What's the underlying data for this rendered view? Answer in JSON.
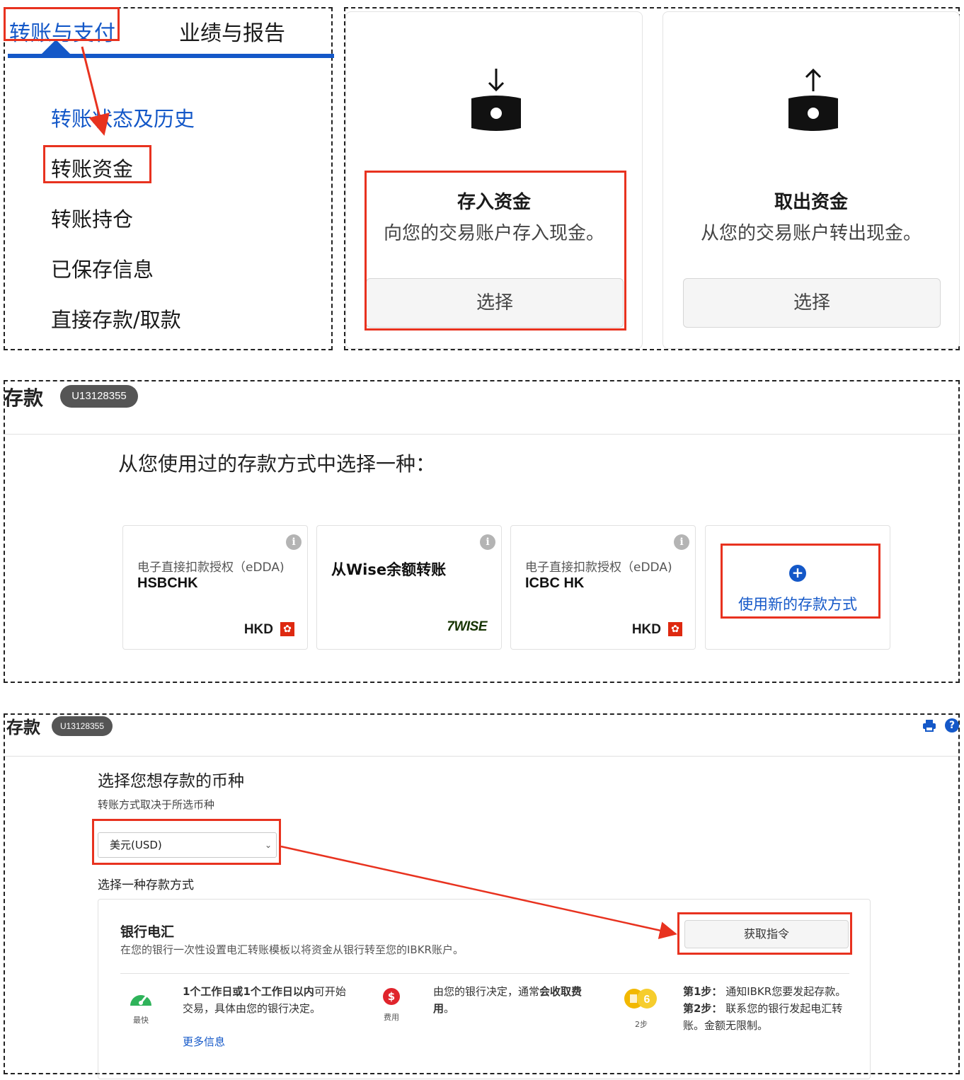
{
  "top_nav": {
    "tabs": [
      {
        "label": "转账与支付",
        "active": true
      },
      {
        "label": "业绩与报告",
        "active": false
      }
    ],
    "menu_items": [
      {
        "label": "转账状态及历史"
      },
      {
        "label": "转账资金"
      },
      {
        "label": "转账持仓"
      },
      {
        "label": "已保存信息"
      },
      {
        "label": "直接存款/取款"
      }
    ]
  },
  "fund_options": {
    "deposit": {
      "title": "存入资金",
      "description": "向您的交易账户存入现金。",
      "button": "选择",
      "icon": "money-arrow-down-icon"
    },
    "withdraw": {
      "title": "取出资金",
      "description": "从您的交易账户转出现金。",
      "button": "选择",
      "icon": "money-arrow-up-icon"
    }
  },
  "deposit_methods_page": {
    "title": "存款",
    "account_id": "U13128355",
    "prompt": "从您使用过的存款方式中选择一种：",
    "methods": [
      {
        "subtitle": "电子直接扣款授权（eDDA)",
        "name": "HSBCHK",
        "currency": "HKD",
        "flag_icon": "hong-kong-flag-icon"
      },
      {
        "title": "从Wise余额转账",
        "logo": "7WISE"
      },
      {
        "subtitle": "电子直接扣款授权（eDDA)",
        "name": "ICBC HK",
        "currency": "HKD",
        "flag_icon": "hong-kong-flag-icon"
      }
    ],
    "new_method_label": "使用新的存款方式"
  },
  "currency_page": {
    "title": "存款",
    "account_id": "U13128355",
    "heading": "选择您想存款的币种",
    "subheading": "转账方式取决于所选币种",
    "selected_currency": "美元(USD)",
    "method_label": "选择一种存款方式",
    "wire": {
      "title": "银行电汇",
      "description": "在您的银行一次性设置电汇转账模板以将资金从银行转至您的IBKR账户。",
      "button": "获取指令",
      "speed": {
        "caption": "最快",
        "text_bold": "1个工作日或1个工作日以内",
        "text_rest": "可开始交易，具体由您的银行决定。",
        "link": "更多信息"
      },
      "fee": {
        "caption": "费用",
        "text_pre": "由您的银行决定，通常",
        "text_bold": "会收取费用",
        "text_post": "。"
      },
      "steps": {
        "caption": "2步",
        "step1_label": "第1步：",
        "step1_text": "通知IBKR您要发起存款。",
        "step2_label": "第2步：",
        "step2_text": "联系您的银行发起电汇转账。金额无限制。"
      }
    }
  },
  "colors": {
    "accent": "#1458c8",
    "highlight": "#e8321f",
    "badge": "#555555"
  }
}
